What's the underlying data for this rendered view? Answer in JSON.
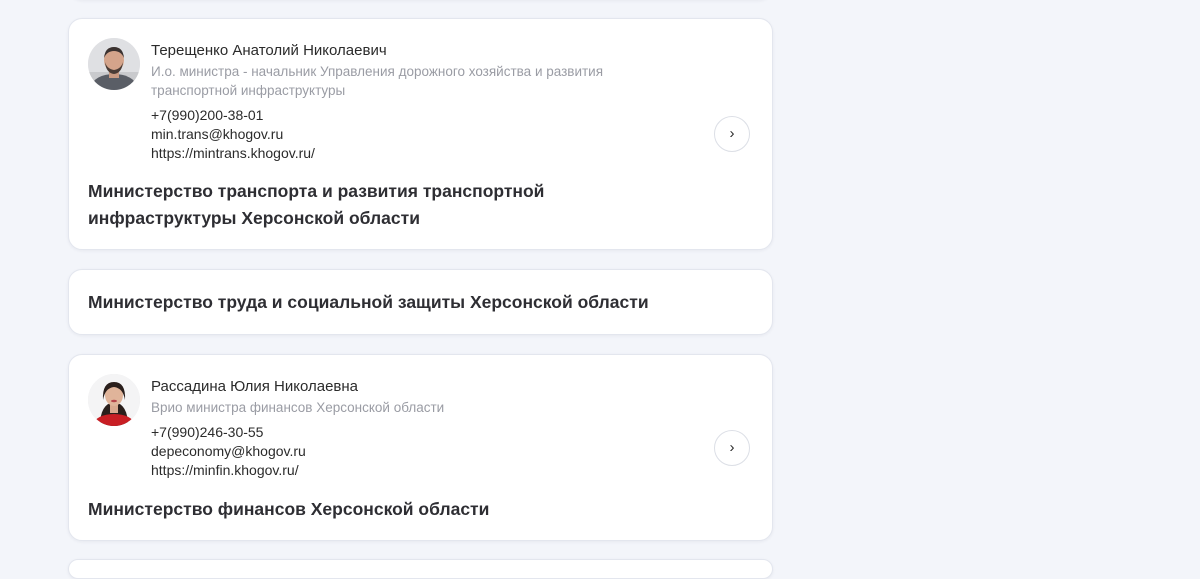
{
  "cards": [
    {
      "person": {
        "name": "Терещенко Анатолий Николаевич",
        "role": "И.о. министра - начальник Управления дорожного хозяйства и развития транспортной инфраструктуры",
        "phone": "+7(990)200-38-01",
        "email": "min.trans@khogov.ru",
        "site": "https://mintrans.khogov.ru/"
      },
      "ministry": "Министерство транспорта и развития транспортной инфраструктуры Херсонской области",
      "arrow_icon": "chevron-right-icon"
    },
    {
      "ministry": "Министерство труда и социальной защиты Херсонской области"
    },
    {
      "person": {
        "name": "Рассадина Юлия Николаевна",
        "role": "Врио министра финансов Херсонской области",
        "phone": "+7(990)246-30-55",
        "email": "depeconomy@khogov.ru",
        "site": "https://minfin.khogov.ru/"
      },
      "ministry": "Министерство финансов Херсонской области",
      "arrow_icon": "chevron-right-icon"
    }
  ],
  "arrow_glyph": "›",
  "colors": {
    "page_bg": "#f3f5fa",
    "card_bg": "#ffffff",
    "card_border": "#e3e6ee",
    "muted_text": "#9a9ca4",
    "text": "#2b2b2b"
  }
}
